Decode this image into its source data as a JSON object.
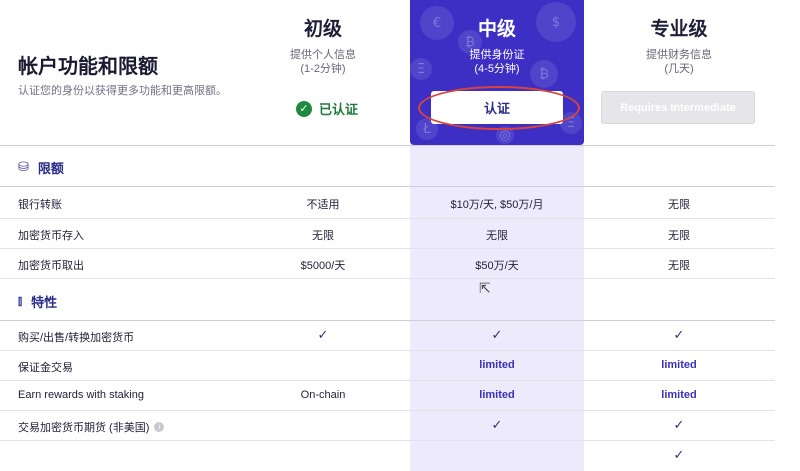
{
  "header": {
    "title": "帐户功能和限额",
    "subtitle": "认证您的身份以获得更多功能和更高限额。"
  },
  "tiers": [
    {
      "name": "初级",
      "desc_line1": "提供个人信息",
      "desc_line2": "(1-2分钟)",
      "status": "已认证"
    },
    {
      "name": "中级",
      "desc_line1": "提供身份证",
      "desc_line2": "(4-5分钟)",
      "button": "认证",
      "accent": "#3d2fc4"
    },
    {
      "name": "专业级",
      "desc_line1": "提供财务信息",
      "desc_line2": "(几天)",
      "button": "Requires Intermediate"
    }
  ],
  "sections": {
    "limits": {
      "icon": "coins-icon",
      "label": "限额"
    },
    "features": {
      "icon": "candlestick-icon",
      "label": "特性"
    }
  },
  "limit_rows": [
    {
      "label": "银行转账",
      "values": [
        "不适用",
        "$10万/天, $50万/月",
        "无限"
      ]
    },
    {
      "label": "加密货币存入",
      "values": [
        "无限",
        "无限",
        "无限"
      ]
    },
    {
      "label": "加密货币取出",
      "values": [
        "$5000/天",
        "$50万/天",
        "无限"
      ]
    }
  ],
  "feature_rows": [
    {
      "label": "购买/出售/转换加密货币",
      "values": [
        "✓",
        "✓",
        "✓"
      ]
    },
    {
      "label": "保证金交易",
      "values": [
        "",
        "limited",
        "limited"
      ]
    },
    {
      "label": "Earn rewards with staking",
      "values": [
        "On-chain",
        "limited",
        "limited"
      ]
    },
    {
      "label": "交易加密货币期货 (非美国)",
      "values": [
        "",
        "✓",
        "✓"
      ],
      "info_icon": "info-icon"
    },
    {
      "label": "",
      "values": [
        "",
        "",
        "✓"
      ]
    }
  ],
  "colors": {
    "accent": "#3d2fc4",
    "column_tint": "#eceafb",
    "verified_green": "#1f8a3f",
    "highlight_ellipse": "#d9433d"
  }
}
